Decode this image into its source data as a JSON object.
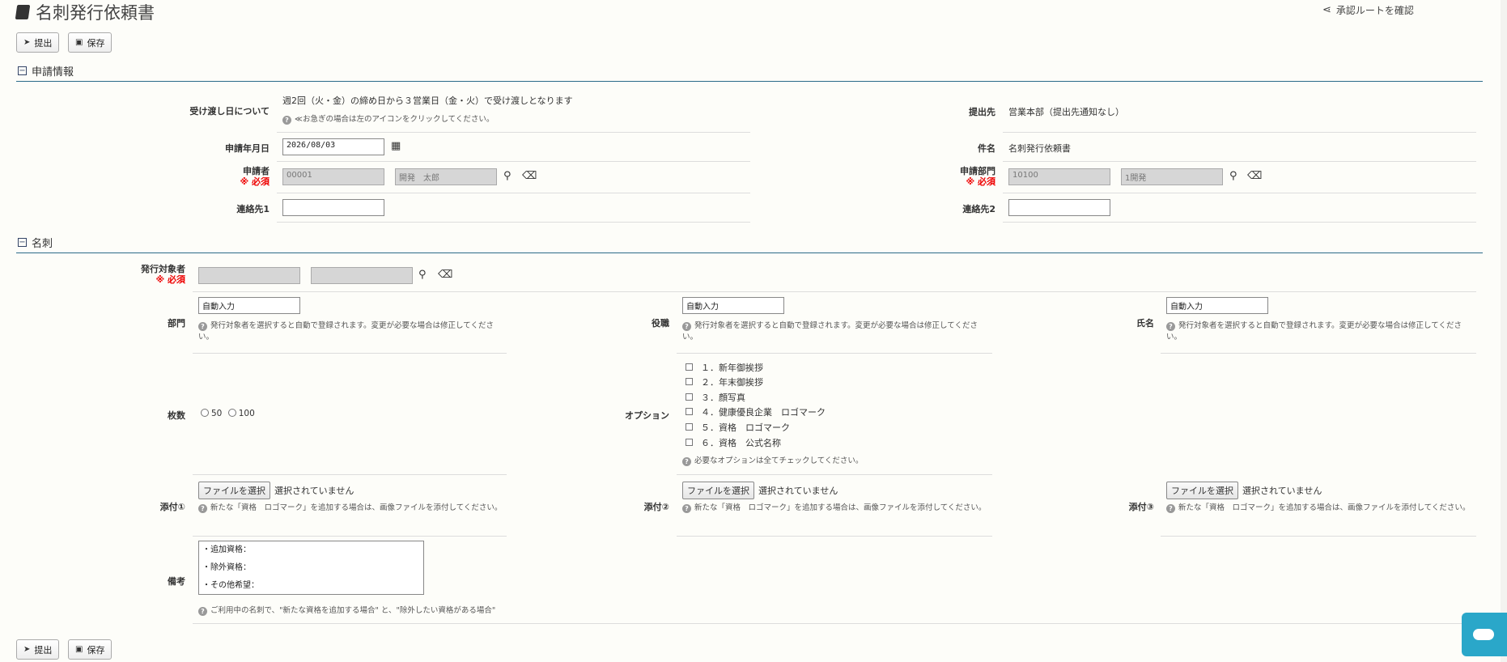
{
  "header": {
    "title": "名刺発行依頼書",
    "route_label": "承認ルートを確認"
  },
  "toolbar": {
    "submit_label": "提出",
    "save_label": "保存"
  },
  "section1": {
    "title": "申請情報",
    "delivery_label": "受け渡し日について",
    "delivery_text": "週2回（火・金）の締め日から３営業日（金・火）で受け渡しとなります",
    "delivery_help": "≪お急ぎの場合は左のアイコンをクリックしてください。",
    "submit_to_label": "提出先",
    "submit_to_value": "営業本部（提出先通知なし）",
    "date_label": "申請年月日",
    "date_value": "2026/08/03",
    "subject_label": "件名",
    "subject_value": "名刺発行依頼書",
    "applicant_label": "申請者",
    "required": "※ 必須",
    "applicant_code": "00001",
    "applicant_name": "開発　太郎",
    "dept_label": "申請部門",
    "dept_code": "10100",
    "dept_name": "1開発",
    "contact1_label": "連絡先1",
    "contact2_label": "連絡先2"
  },
  "section2": {
    "title": "名刺",
    "target_label": "発行対象者",
    "required": "※ 必須",
    "dept_label": "部門",
    "position_label": "役職",
    "name_label": "氏名",
    "auto_value": "自動入力",
    "auto_help": "発行対象者を選択すると自動で登録されます。変更が必要な場合は修正してください。",
    "count_label": "枚数",
    "count_options": [
      "50",
      "100"
    ],
    "option_label": "オプション",
    "options": [
      "１．新年御挨拶",
      "２．年末御挨拶",
      "３．顔写真",
      "４．健康優良企業　ロゴマーク",
      "５．資格　ロゴマーク",
      "６．資格　公式名称"
    ],
    "option_help": "必要なオプションは全てチェックしてください。",
    "attach1_label": "添付①",
    "attach2_label": "添付②",
    "attach3_label": "添付③",
    "file_button": "ファイルを選択",
    "file_status": "選択されていません",
    "attach_help": "新たな「資格　ロゴマーク」を追加する場合は、画像ファイルを添付してください。",
    "note_label": "備考",
    "note_value": "・追加資格：\n・除外資格：\n・その他希望：",
    "note_help": "ご利用中の名刺で、\"新たな資格を追加する場合\" と、\"除外したい資格がある場合\""
  }
}
